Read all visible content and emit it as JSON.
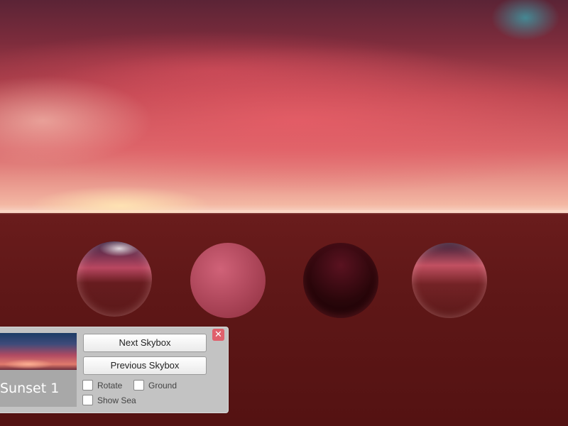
{
  "scene": {
    "objects": [
      "glass-sphere",
      "matte-sphere",
      "dark-glossy-sphere",
      "clear-glass-sphere"
    ]
  },
  "panel": {
    "skybox_name": "Sunset 1",
    "next_label": "Next Skybox",
    "prev_label": "Previous Skybox",
    "close_label": "✕",
    "options": {
      "rotate": {
        "label": "Rotate",
        "checked": false
      },
      "ground": {
        "label": "Ground",
        "checked": false
      },
      "sea": {
        "label": "Show Sea",
        "checked": false
      }
    }
  },
  "colors": {
    "close": "#e0606c",
    "panel": "#c3c3c3",
    "ground": "#5e1717"
  }
}
